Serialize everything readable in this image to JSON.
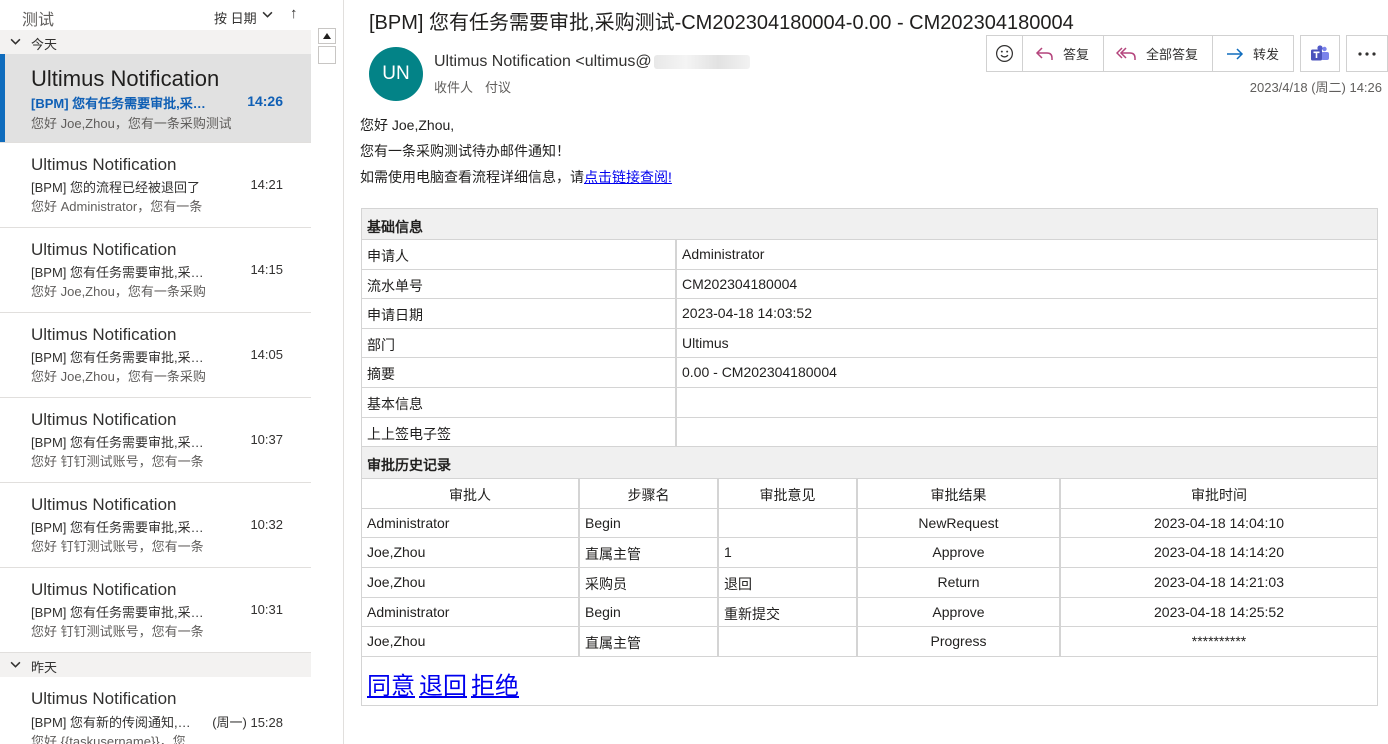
{
  "list": {
    "folder_name": "测试",
    "sort_label": "按 日期",
    "sort_arrow": "↑",
    "groups": [
      {
        "label": "今天"
      },
      {
        "label": "昨天"
      }
    ],
    "items": [
      {
        "sender": "Ultimus Notification",
        "subject": "[BPM] 您有任务需要审批,采购测试",
        "time": "14:26",
        "preview": "您好 Joe,Zhou，您有一条采购测试待办邮件通知"
      },
      {
        "sender": "Ultimus Notification",
        "subject": "[BPM] 您的流程已经被退回了",
        "time": "14:21",
        "preview": "您好 Administrator，您有一条"
      },
      {
        "sender": "Ultimus Notification",
        "subject": "[BPM] 您有任务需要审批,采购测试",
        "time": "14:15",
        "preview": "您好 Joe,Zhou，您有一条采购"
      },
      {
        "sender": "Ultimus Notification",
        "subject": "[BPM] 您有任务需要审批,采购测试",
        "time": "14:05",
        "preview": "您好 Joe,Zhou，您有一条采购"
      },
      {
        "sender": "Ultimus Notification",
        "subject": "[BPM] 您有任务需要审批,采购测试",
        "time": "10:37",
        "preview": "您好 钉钉测试账号，您有一条"
      },
      {
        "sender": "Ultimus Notification",
        "subject": "[BPM] 您有任务需要审批,采购测试",
        "time": "10:32",
        "preview": "您好 钉钉测试账号，您有一条"
      },
      {
        "sender": "Ultimus Notification",
        "subject": "[BPM] 您有任务需要审批,采购测试",
        "time": "10:31",
        "preview": "您好 钉钉测试账号，您有一条"
      },
      {
        "sender": "Ultimus Notification",
        "subject": "[BPM] 您有新的传阅通知,请查看",
        "time": "(周一) 15:28",
        "preview": "您好 {{taskusername}}，您"
      }
    ]
  },
  "mail": {
    "title": "[BPM] 您有任务需要审批,采购测试-CM202304180004-0.00 - CM202304180004",
    "avatar_initials": "UN",
    "sender": "Ultimus Notification <ultimus@",
    "recipient_label": "收件人",
    "recipient": "付议",
    "received_time": "2023/4/18 (周二) 14:26",
    "actions": {
      "reply": "答复",
      "reply_all": "全部答复",
      "forward": "转发"
    },
    "body": {
      "greeting": "您好 Joe,Zhou,",
      "line1": "您有一条采购测试待办邮件通知！",
      "line2_prefix": "如需使用电脑查看流程详细信息，请",
      "line2_link": "点击链接查阅!"
    },
    "basic_info": {
      "title": "基础信息",
      "rows": [
        {
          "key": "申请人",
          "value": "Administrator"
        },
        {
          "key": "流水单号",
          "value": "CM202304180004"
        },
        {
          "key": "申请日期",
          "value": "2023-04-18 14:03:52"
        },
        {
          "key": "部门",
          "value": "Ultimus"
        },
        {
          "key": "摘要",
          "value": "0.00 - CM202304180004"
        },
        {
          "key": "基本信息",
          "value": ""
        },
        {
          "key": "上上签电子签",
          "value": ""
        }
      ]
    },
    "history": {
      "title": "审批历史记录",
      "headers": [
        "审批人",
        "步骤名",
        "审批意见",
        "审批结果",
        "审批时间"
      ],
      "rows": [
        [
          "Administrator",
          "Begin",
          "",
          "NewRequest",
          "2023-04-18 14:04:10"
        ],
        [
          "Joe,Zhou",
          "直属主管",
          "1",
          "Approve",
          "2023-04-18 14:14:20"
        ],
        [
          "Joe,Zhou",
          "采购员",
          "退回",
          "Return",
          "2023-04-18 14:21:03"
        ],
        [
          "Administrator",
          "Begin",
          "重新提交",
          "Approve",
          "2023-04-18 14:25:52"
        ],
        [
          "Joe,Zhou",
          "直属主管",
          "",
          "Progress",
          "**********"
        ]
      ]
    },
    "links": {
      "approve": "同意",
      "return": "退回",
      "reject": "拒绝"
    }
  }
}
